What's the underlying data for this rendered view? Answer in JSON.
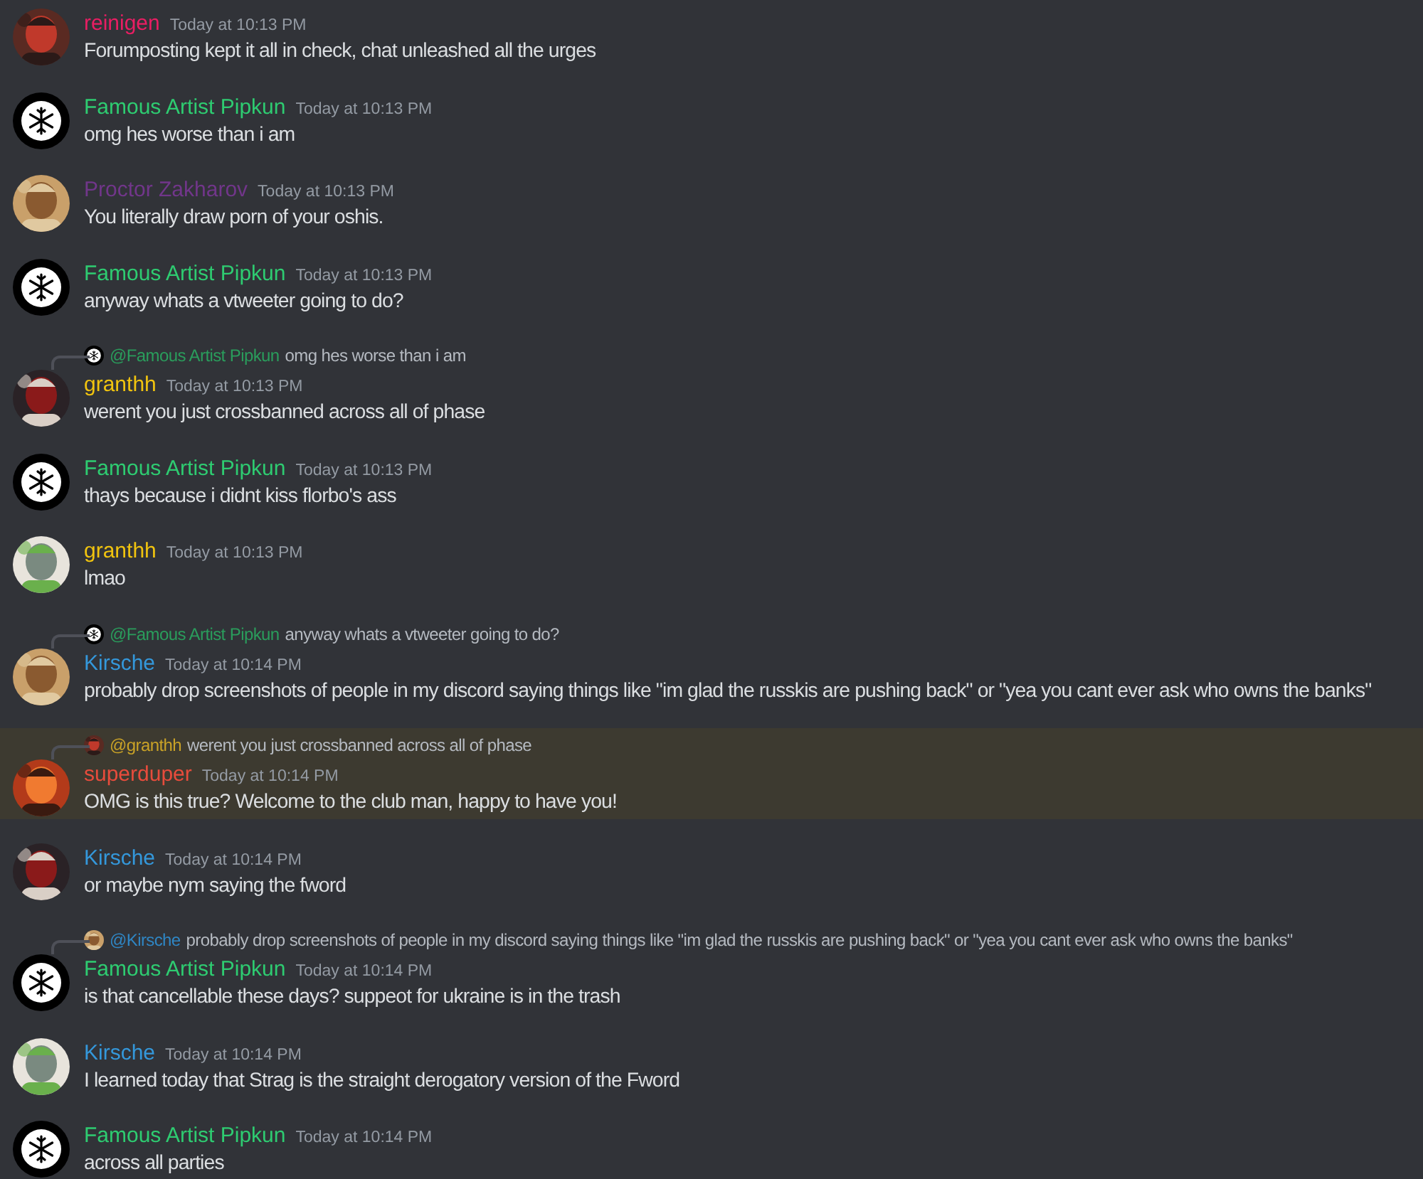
{
  "messages": [
    {
      "author": "reinigen",
      "color": "#e91e63",
      "time": "Today at 10:13 PM",
      "text": "Forumposting kept it all in check, chat unleashed all the urges",
      "highlighted": false
    },
    {
      "avatar": {
        "kind": "snowflake"
      },
      "author": "Famous Artist Pipkun",
      "color": "#2ecc71",
      "time": "Today at 10:13 PM",
      "text": "omg hes worse than i am",
      "highlighted": false
    },
    {
      "author": "Proctor Zakharov",
      "color": "#71368a",
      "time": "Today at 10:13 PM",
      "text": "You literally draw porn of your oshis.",
      "highlighted": false
    },
    {
      "avatar": {
        "kind": "snowflake"
      },
      "author": "Famous Artist Pipkun",
      "color": "#2ecc71",
      "time": "Today at 10:13 PM",
      "text": "anyway whats a vtweeter going to do?",
      "highlighted": false
    },
    {
      "reply": {
        "avatar": {
          "kind": "snowflake"
        },
        "author": "@Famous Artist Pipkun",
        "color": "#2a9d5c",
        "text": "omg hes worse than i am"
      },
      "author": "granthh",
      "color": "#f1c40f",
      "time": "Today at 10:13 PM",
      "text": "werent you just crossbanned across all of phase",
      "highlighted": false
    },
    {
      "avatar": {
        "kind": "snowflake"
      },
      "author": "Famous Artist Pipkun",
      "color": "#2ecc71",
      "time": "Today at 10:13 PM",
      "text": "thays because i didnt kiss florbo's ass",
      "highlighted": false
    },
    {
      "author": "granthh",
      "color": "#f1c40f",
      "time": "Today at 10:13 PM",
      "text": "lmao",
      "highlighted": false
    },
    {
      "reply": {
        "avatar": {
          "kind": "snowflake"
        },
        "author": "@Famous Artist Pipkun",
        "color": "#2a9d5c",
        "text": "anyway whats a vtweeter going to do?"
      },
      "author": "Kirsche",
      "color": "#3498db",
      "time": "Today at 10:14 PM",
      "text": "probably drop screenshots of people in my discord saying things like \"im glad the russkis are pushing back\" or \"yea you cant ever ask who owns the banks\"",
      "highlighted": false
    },
    {
      "reply": {
        "author": "@granthh",
        "color": "#c9a227",
        "text": "werent you just crossbanned across all of phase"
      },
      "author": "superduper",
      "color": "#e74c3c",
      "time": "Today at 10:14 PM",
      "text": "OMG is this true?  Welcome to the club man, happy to have you!",
      "highlighted": true
    },
    {
      "author": "Kirsche",
      "color": "#3498db",
      "time": "Today at 10:14 PM",
      "text": "or maybe nym saying the fword",
      "highlighted": false
    },
    {
      "reply": {
        "author": "@Kirsche",
        "color": "#2f86c4",
        "text": "probably drop screenshots of people in my discord saying things like \"im glad the russkis are pushing back\" or \"yea you cant ever ask who owns the banks\""
      },
      "avatar": {
        "kind": "snowflake"
      },
      "author": "Famous Artist Pipkun",
      "color": "#2ecc71",
      "time": "Today at 10:14 PM",
      "text": "is that cancellable these days? suppeot for ukraine is in the trash",
      "highlighted": false
    },
    {
      "author": "Kirsche",
      "color": "#3498db",
      "time": "Today at 10:14 PM",
      "text": "I learned today that Strag is the straight derogatory version of the Fword",
      "highlighted": false
    },
    {
      "avatar": {
        "kind": "snowflake"
      },
      "author": "Famous Artist Pipkun",
      "color": "#2ecc71",
      "time": "Today at 10:14 PM",
      "text": "across all parties",
      "highlighted": false
    }
  ]
}
